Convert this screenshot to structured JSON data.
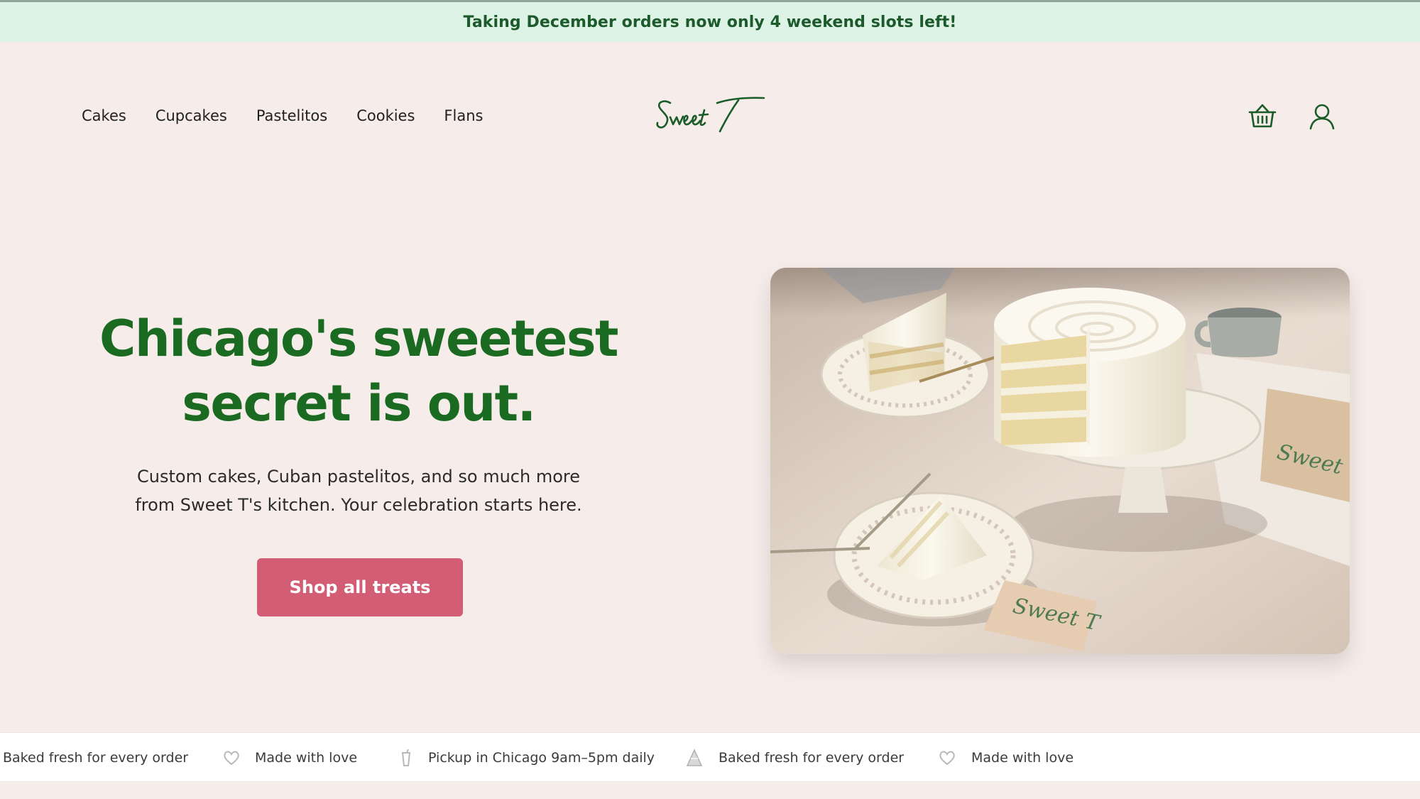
{
  "announcement": {
    "text": "Taking December orders now only 4 weekend slots left!"
  },
  "nav": {
    "items": [
      {
        "label": "Cakes"
      },
      {
        "label": "Cupcakes"
      },
      {
        "label": "Pastelitos"
      },
      {
        "label": "Cookies"
      },
      {
        "label": "Flans"
      }
    ]
  },
  "brand": {
    "name": "Sweet T"
  },
  "header_icons": {
    "cart": "basket-icon",
    "account": "user-icon"
  },
  "hero": {
    "title_line1": "Chicago's sweetest",
    "title_line2": "secret is out.",
    "subtitle_line1": "Custom cakes, Cuban pastelitos, and so much more",
    "subtitle_line2": "from Sweet T's kitchen. Your celebration starts here.",
    "cta_label": "Shop all treats"
  },
  "marquee": {
    "items": [
      {
        "icon": "cake-slice-icon",
        "text": "Baked fresh for every order"
      },
      {
        "icon": "heart-icon",
        "text": "Made with love"
      },
      {
        "icon": "cup-icon",
        "text": "Pickup in Chicago 9am–5pm daily"
      },
      {
        "icon": "cake-slice-icon",
        "text": "Baked fresh for every order"
      },
      {
        "icon": "heart-icon",
        "text": "Made with love"
      }
    ]
  },
  "colors": {
    "background": "#f6ece9",
    "announcement_bg": "#dcf3e6",
    "brand_green": "#1a6a21",
    "cta_pink": "#d35d74"
  }
}
